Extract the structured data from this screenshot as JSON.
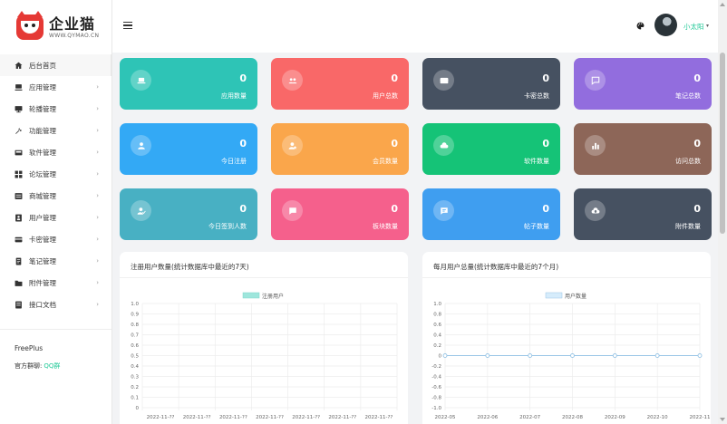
{
  "brand": {
    "name": "企业猫",
    "url": "WWW.QYMAO.CN"
  },
  "nav": [
    {
      "label": "后台首页",
      "icon": "home-icon",
      "arrow": false
    },
    {
      "label": "应用管理",
      "icon": "monitor-icon",
      "arrow": true
    },
    {
      "label": "轮播管理",
      "icon": "slideshow-icon",
      "arrow": true
    },
    {
      "label": "功能管理",
      "icon": "tools-icon",
      "arrow": true
    },
    {
      "label": "软件管理",
      "icon": "software-icon",
      "arrow": true
    },
    {
      "label": "论坛管理",
      "icon": "grid-icon",
      "arrow": true
    },
    {
      "label": "商城管理",
      "icon": "store-icon",
      "arrow": true
    },
    {
      "label": "用户管理",
      "icon": "user-card-icon",
      "arrow": true
    },
    {
      "label": "卡密管理",
      "icon": "card-icon",
      "arrow": true
    },
    {
      "label": "笔记管理",
      "icon": "note-icon",
      "arrow": true
    },
    {
      "label": "附件管理",
      "icon": "folder-icon",
      "arrow": true
    },
    {
      "label": "接口文档",
      "icon": "doc-icon",
      "arrow": true
    }
  ],
  "nav_arrow": "›",
  "footer": {
    "app": "FreePlus",
    "group_label": "官方群聊:",
    "group_link": "QQ群"
  },
  "header": {
    "user_name": "小太阳",
    "caret": "▾"
  },
  "cards": [
    {
      "label": "应用数量",
      "value": "0",
      "color": "#2ec4b6",
      "icon": "laptop-icon"
    },
    {
      "label": "用户总数",
      "value": "0",
      "color": "#f96868",
      "icon": "users-icon"
    },
    {
      "label": "卡密总数",
      "value": "0",
      "color": "#465161",
      "icon": "card-icon"
    },
    {
      "label": "笔记总数",
      "value": "0",
      "color": "#926dde",
      "icon": "chat-icon"
    },
    {
      "label": "今日注册",
      "value": "0",
      "color": "#33a9f5",
      "icon": "user-icon"
    },
    {
      "label": "会员数量",
      "value": "0",
      "color": "#faa64b",
      "icon": "member-icon"
    },
    {
      "label": "软件数量",
      "value": "0",
      "color": "#15c377",
      "icon": "cloud-icon"
    },
    {
      "label": "访问总数",
      "value": "0",
      "color": "#8d6658",
      "icon": "chart-icon"
    },
    {
      "label": "今日签到人数",
      "value": "0",
      "color": "#48b0c3",
      "icon": "checkin-icon"
    },
    {
      "label": "板块数量",
      "value": "0",
      "color": "#f5608c",
      "icon": "message-icon"
    },
    {
      "label": "帖子数量",
      "value": "0",
      "color": "#3f9ef0",
      "icon": "post-icon"
    },
    {
      "label": "附件数量",
      "value": "0",
      "color": "#465161",
      "icon": "upload-icon"
    }
  ],
  "panels": [
    {
      "title": "注册用户数量(统计数据库中最近的7天)"
    },
    {
      "title": "每月用户总量(统计数据库中最近的7个月)"
    }
  ],
  "chart_data": [
    {
      "type": "bar",
      "legend": [
        "注册用户"
      ],
      "legend_color": "#9ee6dc",
      "ylim": [
        0,
        1.0
      ],
      "yticks": [
        "1.0",
        "0.9",
        "0.8",
        "0.7",
        "0.6",
        "0.5",
        "0.4",
        "0.3",
        "0.2",
        "0.1",
        "0"
      ],
      "categories": [
        "2022-11-??",
        "2022-11-??",
        "2022-11-??",
        "2022-11-??",
        "2022-11-??",
        "2022-11-??",
        "2022-11-??"
      ],
      "series": [
        {
          "name": "注册用户",
          "values": [
            0,
            0,
            0,
            0,
            0,
            0,
            0
          ]
        }
      ]
    },
    {
      "type": "line",
      "legend": [
        "用户数量"
      ],
      "legend_color": "#d6ecfb",
      "line_color": "#9ac6e6",
      "ylim": [
        -1.0,
        1.0
      ],
      "yticks": [
        "1.0",
        "0.8",
        "0.6",
        "0.4",
        "0.2",
        "0",
        "-0.2",
        "-0.4",
        "-0.6",
        "-0.8",
        "-1.0"
      ],
      "categories": [
        "2022-05",
        "2022-06",
        "2022-07",
        "2022-08",
        "2022-09",
        "2022-10",
        "2022-11"
      ],
      "series": [
        {
          "name": "用户数量",
          "values": [
            0,
            0,
            0,
            0,
            0,
            0,
            0
          ]
        }
      ]
    }
  ]
}
